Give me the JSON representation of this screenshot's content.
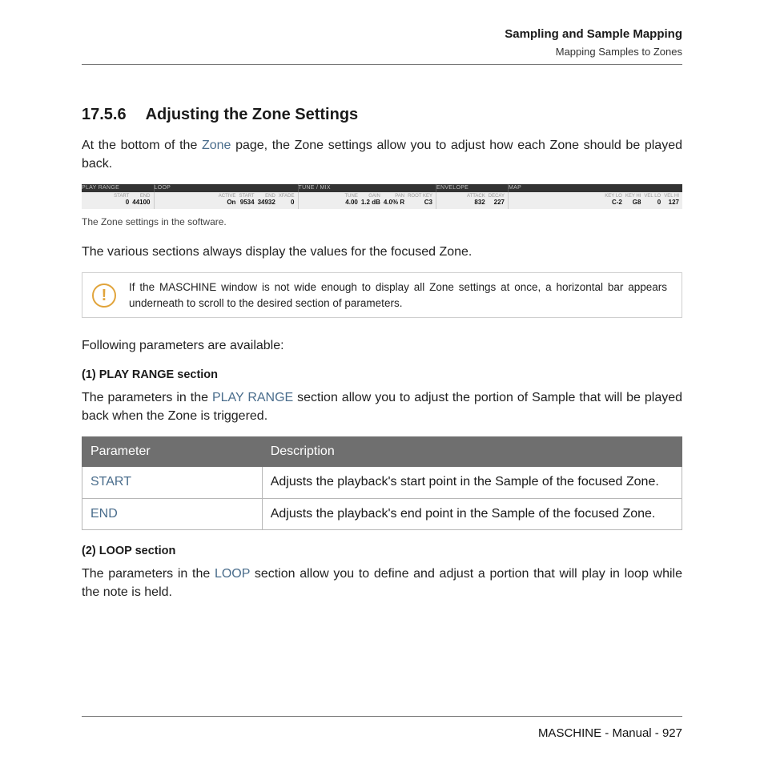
{
  "running_header": {
    "chapter": "Sampling and Sample Mapping",
    "section": "Mapping Samples to Zones"
  },
  "heading": {
    "number": "17.5.6",
    "title": "Adjusting the Zone Settings"
  },
  "intro_before": "At the bottom of the ",
  "intro_link": "Zone",
  "intro_after": " page, the Zone settings allow you to adjust how each Zone should be played back.",
  "zone_strip": {
    "groups": [
      {
        "name": "PLAY RANGE",
        "params": [
          {
            "label": "START",
            "value": "0"
          },
          {
            "label": "END",
            "value": "44100"
          }
        ]
      },
      {
        "name": "LOOP",
        "params": [
          {
            "label": "ACTIVE",
            "value": "On"
          },
          {
            "label": "START",
            "value": "9534"
          },
          {
            "label": "END",
            "value": "34932"
          },
          {
            "label": "XFADE",
            "value": "0"
          }
        ]
      },
      {
        "name": "TUNE / MIX",
        "params": [
          {
            "label": "TUNE",
            "value": "4.00"
          },
          {
            "label": "GAIN",
            "value": "1.2 dB"
          },
          {
            "label": "PAN",
            "value": "4.0% R"
          },
          {
            "label": "ROOT KEY",
            "value": "C3"
          }
        ]
      },
      {
        "name": "ENVELOPE",
        "params": [
          {
            "label": "ATTACK",
            "value": "832"
          },
          {
            "label": "DECAY",
            "value": "227"
          }
        ]
      },
      {
        "name": "MAP",
        "params": [
          {
            "label": "KEY LO",
            "value": "C-2"
          },
          {
            "label": "KEY HI",
            "value": "G8"
          },
          {
            "label": "VEL LO",
            "value": "0"
          },
          {
            "label": "VEL HI",
            "value": "127"
          }
        ]
      }
    ]
  },
  "caption": "The Zone settings in the software.",
  "line_various": "The various sections always display the values for the focused Zone.",
  "note": "If the MASCHINE window is not wide enough to display all Zone settings at once, a horizontal bar appears underneath to scroll to the desired section of parameters.",
  "following": "Following parameters are available:",
  "section1": {
    "title": "(1) PLAY RANGE section",
    "text_before": "The parameters in the ",
    "text_link": "PLAY RANGE",
    "text_after": " section allow you to adjust the portion of Sample that will be played back when the Zone is triggered."
  },
  "table": {
    "headers": [
      "Parameter",
      "Description"
    ],
    "rows": [
      {
        "param": "START",
        "desc": "Adjusts the playback's start point in the Sample of the focused Zone."
      },
      {
        "param": "END",
        "desc": "Adjusts the playback's end point in the Sample of the focused Zone."
      }
    ]
  },
  "section2": {
    "title": "(2) LOOP section",
    "text_before": "The parameters in the ",
    "text_link": "LOOP",
    "text_after": " section allow you to define and adjust a portion that will play in loop while the note is held."
  },
  "footer": "MASCHINE - Manual - 927"
}
